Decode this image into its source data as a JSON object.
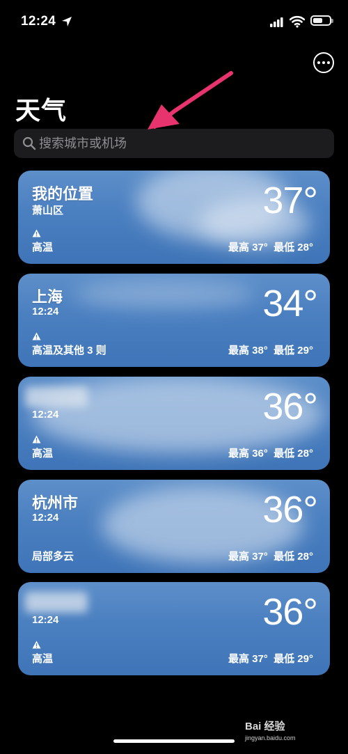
{
  "status_bar": {
    "time": "12:24"
  },
  "header": {
    "title": "天气"
  },
  "search": {
    "placeholder": "搜索城市或机场"
  },
  "locations": [
    {
      "name": "我的位置",
      "sub": "萧山区",
      "temp": "37°",
      "condition": "高温",
      "high": "最高 37°",
      "low": "最低 28°"
    },
    {
      "name": "上海",
      "sub": "12:24",
      "temp": "34°",
      "condition": "高温及其他 3 则",
      "high": "最高 38°",
      "low": "最低 29°"
    },
    {
      "name": "",
      "sub": "12:24",
      "temp": "36°",
      "condition": "高温",
      "high": "最高 36°",
      "low": "最低 28°"
    },
    {
      "name": "杭州市",
      "sub": "12:24",
      "temp": "36°",
      "condition": "局部多云",
      "high": "最高 37°",
      "low": "最低 28°"
    },
    {
      "name": "",
      "sub": "12:24",
      "temp": "36°",
      "condition": "高温",
      "high": "最高 37°",
      "low": "最低 29°"
    }
  ],
  "watermark": {
    "text": "Bai 经验",
    "sub": "jingyan.baidu.com"
  },
  "colors": {
    "card_blue": "#4a7fc0",
    "search_bg": "#1c1c1e",
    "annotation_pink": "#e8346e"
  }
}
